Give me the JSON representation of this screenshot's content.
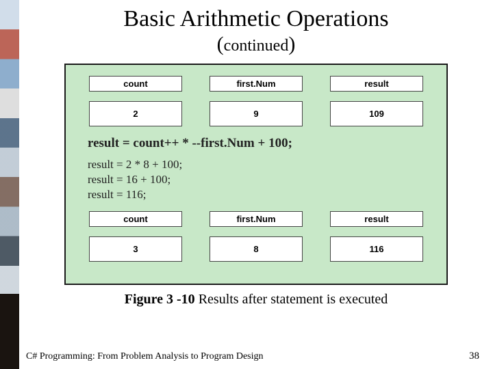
{
  "title": {
    "line1": "Basic Arithmetic Operations",
    "line2_open": "(",
    "line2_mid": "continued",
    "line2_close": ")"
  },
  "figure": {
    "headers_top": [
      "count",
      "first.Num",
      "result"
    ],
    "values_before": [
      "2",
      "9",
      "109"
    ],
    "formula": "result = count++ * --first.Num + 100;",
    "calc": [
      "result = 2 * 8 + 100;",
      "result = 16 + 100;",
      "result = 116;"
    ],
    "headers_bottom": [
      "count",
      "first.Num",
      "result"
    ],
    "values_after": [
      "3",
      "8",
      "116"
    ]
  },
  "caption": {
    "bold": "Figure 3 -10 ",
    "rest": "Results after statement is executed"
  },
  "footer": "C# Programming: From Problem Analysis to Program Design",
  "page_number": "38"
}
